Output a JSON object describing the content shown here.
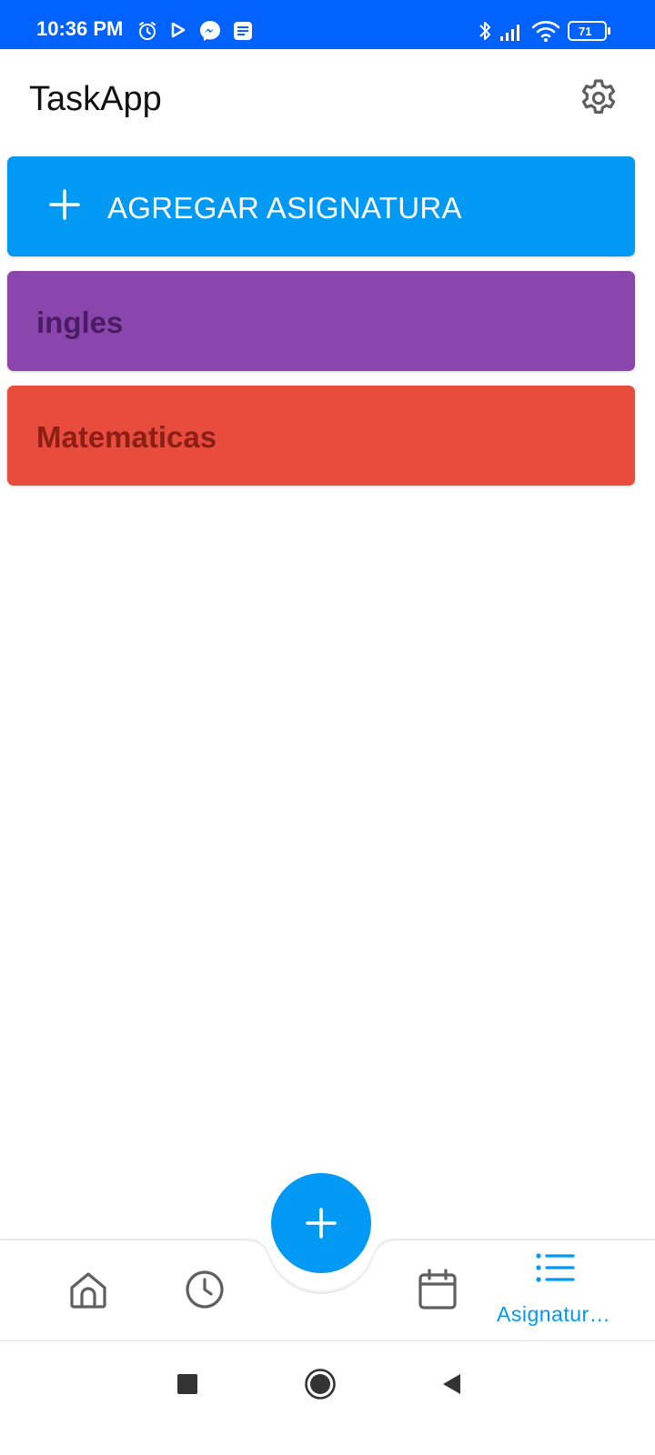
{
  "status_bar": {
    "time": "10:36 PM",
    "battery": "71",
    "left_icons": [
      "alarm-icon",
      "play-icon",
      "messenger-icon",
      "message-icon"
    ],
    "right_icons": [
      "bluetooth-icon",
      "signal-icon",
      "wifi-icon",
      "battery-icon"
    ],
    "background": "#0162fd"
  },
  "app_bar": {
    "title": "TaskApp",
    "settings_icon": "gear-icon"
  },
  "add_subject": {
    "label": "AGREGAR ASIGNATURA",
    "icon": "plus-icon",
    "color": "#0199f4"
  },
  "subjects": [
    {
      "name": "ingles",
      "color": "#8a46ad",
      "text_color": "#4a1c63"
    },
    {
      "name": "Matematicas",
      "color": "#e74c3c",
      "text_color": "#8b1f16"
    }
  ],
  "bottom_nav": {
    "items": [
      {
        "icon": "home-icon",
        "label": ""
      },
      {
        "icon": "clock-icon",
        "label": ""
      },
      {
        "icon": "calendar-icon",
        "label": ""
      },
      {
        "icon": "list-icon",
        "label": "Asignatur…"
      }
    ],
    "fab_icon": "plus-icon",
    "active_color": "#0199f4"
  },
  "system_nav": {
    "buttons": [
      "recents-square-icon",
      "home-circle-icon",
      "back-triangle-icon"
    ]
  }
}
